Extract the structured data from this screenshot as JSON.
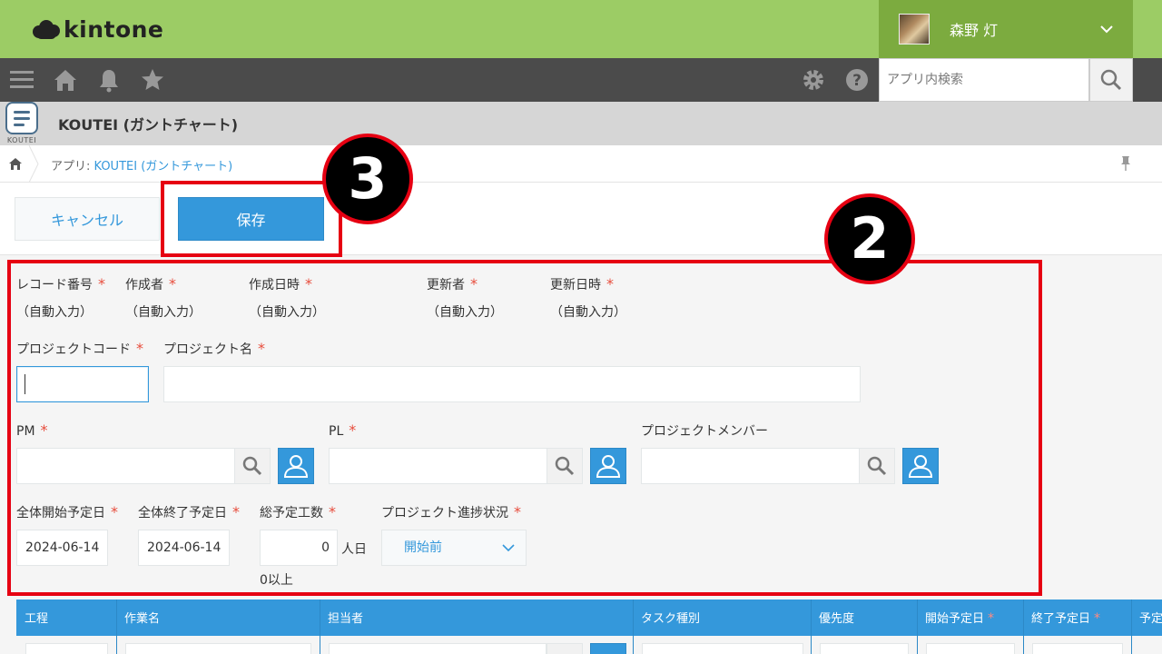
{
  "header": {
    "brand": "kintone",
    "user_name": "森野 灯",
    "search_placeholder": "アプリ内検索"
  },
  "app": {
    "icon_label": "KOUTEI",
    "title": "KOUTEI (ガントチャート)"
  },
  "breadcrumb": {
    "prefix": "アプリ: ",
    "link": "KOUTEI (ガントチャート)"
  },
  "actions": {
    "cancel_label": "キャンセル",
    "save_label": "保存"
  },
  "annotations": {
    "badge_save": "3",
    "badge_form": "2",
    "color": "#e60012"
  },
  "form": {
    "record_number": {
      "label": "レコード番号",
      "value": "（自動入力）"
    },
    "creator": {
      "label": "作成者",
      "value": "（自動入力）"
    },
    "created_at": {
      "label": "作成日時",
      "value": "（自動入力）"
    },
    "updater": {
      "label": "更新者",
      "value": "（自動入力）"
    },
    "updated_at": {
      "label": "更新日時",
      "value": "（自動入力）"
    },
    "project_code": {
      "label": "プロジェクトコード",
      "value": ""
    },
    "project_name": {
      "label": "プロジェクト名",
      "value": ""
    },
    "pm": {
      "label": "PM"
    },
    "pl": {
      "label": "PL"
    },
    "members": {
      "label": "プロジェクトメンバー"
    },
    "start_date": {
      "label": "全体開始予定日",
      "value": "2024-06-14"
    },
    "end_date": {
      "label": "全体終了予定日",
      "value": "2024-06-14"
    },
    "effort": {
      "label": "総予定工数",
      "value": "0",
      "unit": "人日",
      "hint": "0以上"
    },
    "status": {
      "label": "プロジェクト進捗状況",
      "value": "開始前"
    },
    "required_mark": "*"
  },
  "table": {
    "columns": [
      "工程",
      "作業名",
      "担当者",
      "タスク種別",
      "優先度",
      "開始予定日",
      "終了予定日",
      "予定"
    ]
  },
  "colors": {
    "topbar": "#9ccc65",
    "navbar": "#4b4b4b",
    "accent": "#3498db"
  }
}
